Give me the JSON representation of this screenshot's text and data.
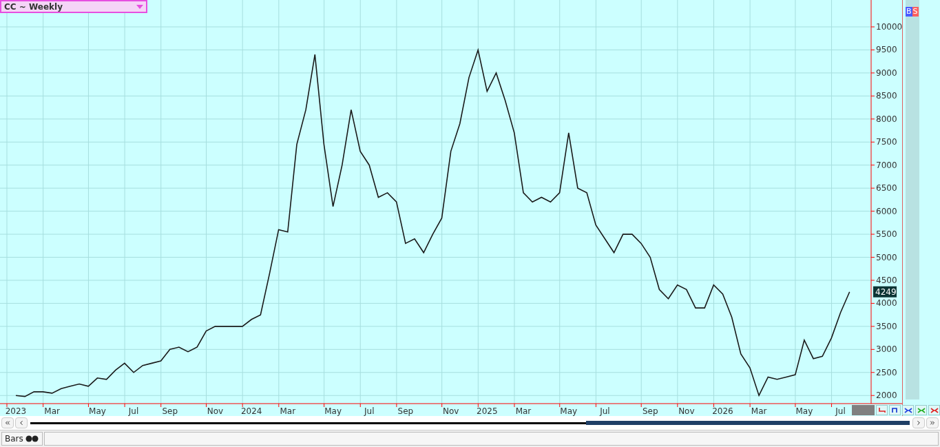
{
  "symbol_selector": {
    "label": "CC ~ Weekly"
  },
  "signal_tags": [
    {
      "label": "B",
      "kind": "buy"
    },
    {
      "label": "S",
      "kind": "sell"
    }
  ],
  "chart": {
    "chart_data": {
      "type": "line",
      "grid": true,
      "ylim": [
        1824,
        10583
      ],
      "yticks": [
        2000,
        2500,
        3000,
        3500,
        4000,
        4500,
        5000,
        5500,
        6000,
        6500,
        7000,
        7500,
        8000,
        8500,
        9000,
        9500,
        10000
      ],
      "categories": [
        "2023",
        null,
        null,
        null,
        "Mar",
        null,
        null,
        null,
        null,
        "May",
        null,
        null,
        null,
        "Jul",
        null,
        null,
        null,
        "Sep",
        null,
        null,
        null,
        null,
        "Nov",
        null,
        null,
        null,
        "2024",
        null,
        null,
        null,
        "Mar",
        null,
        null,
        null,
        null,
        "May",
        null,
        null,
        null,
        "Jul",
        null,
        null,
        null,
        "Sep",
        null,
        null,
        null,
        null,
        "Nov",
        null,
        null,
        null,
        "2025",
        null,
        null,
        null,
        "Mar",
        null,
        null,
        null,
        null,
        "May",
        null,
        null,
        null,
        "Jul",
        null,
        null,
        null,
        null,
        "Sep",
        null,
        null,
        null,
        "Nov",
        null,
        null,
        null,
        "2026",
        null,
        null,
        null,
        "Mar",
        null,
        null,
        null,
        null,
        "May",
        null,
        null,
        null,
        "Jul",
        null
      ],
      "series": [
        {
          "color": "#1a1a1a",
          "values": [
            2000,
            1980,
            2080,
            2080,
            2050,
            2150,
            2200,
            2250,
            2200,
            2380,
            2350,
            2550,
            2700,
            2500,
            2650,
            2700,
            2750,
            3000,
            3050,
            2950,
            3050,
            3400,
            3500,
            3500,
            3500,
            3500,
            3650,
            3750,
            4650,
            5600,
            5550,
            7450,
            8200,
            9400,
            7450,
            6100,
            7000,
            8200,
            7300,
            7000,
            6300,
            6400,
            6200,
            5300,
            5400,
            5100,
            5500,
            5850,
            7300,
            7900,
            8900,
            9500,
            8600,
            9000,
            8400,
            7700,
            6400,
            6200,
            6300,
            6200,
            6400,
            7700,
            6500,
            6400,
            5700,
            5400,
            5100,
            5500,
            5500,
            5300,
            5000,
            4300,
            4100,
            4400,
            4300,
            3900,
            3900,
            4400,
            4200,
            3700,
            2900,
            2600,
            2000,
            2400,
            2350,
            2400,
            2450,
            3200,
            2800,
            2850,
            3250,
            3800,
            4250
          ]
        }
      ]
    },
    "last_price": "4249"
  },
  "status_bar": {
    "label": "Bars"
  }
}
